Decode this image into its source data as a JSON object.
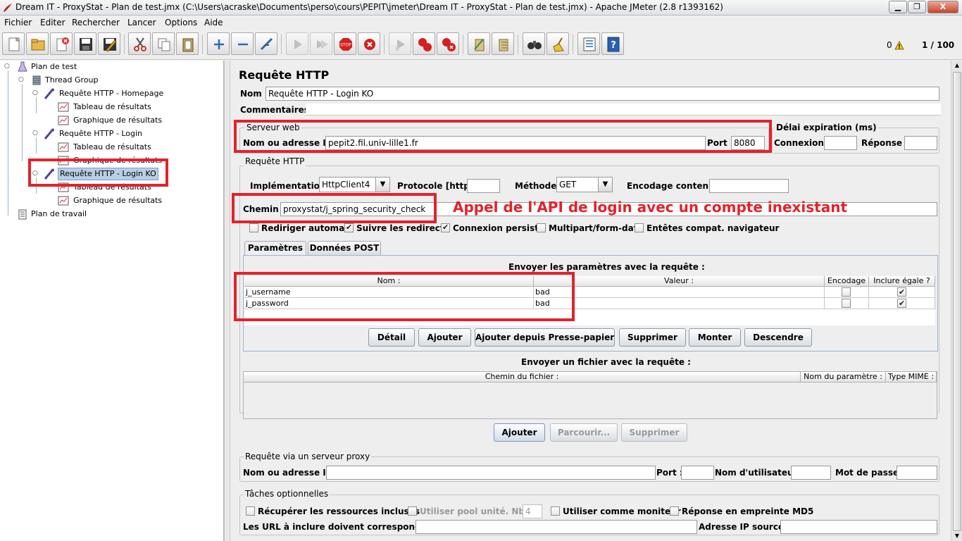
{
  "window": {
    "title": "Dream IT - ProxyStat - Plan de test.jmx (C:\\Users\\acraske\\Documents\\perso\\cours\\PEPIT\\jmeter\\Dream IT - ProxyStat - Plan de test.jmx) - Apache JMeter (2.8 r1393162)",
    "minimize": "▁",
    "maximize": "❐",
    "close": "X"
  },
  "menu": [
    "Fichier",
    "Editer",
    "Rechercher",
    "Lancer",
    "Options",
    "Aide"
  ],
  "toolbar": {
    "error_count": "0",
    "threads": "1 / 100",
    "icons": [
      "new-icon",
      "open-icon",
      "close-file-icon",
      "save-icon",
      "save-as-icon",
      "cut-icon",
      "copy-icon",
      "paste-icon",
      "expand-icon",
      "collapse-icon",
      "toggle-icon",
      "start-icon",
      "start-no-pause-icon",
      "stop-icon",
      "shutdown-icon",
      "remote-start-icon",
      "remote-stop-icon",
      "remote-shutdown-icon",
      "clear-icon",
      "clear-all-icon",
      "search-icon",
      "reset-search-icon",
      "function-helper-icon",
      "help-icon"
    ]
  },
  "tree": [
    {
      "label": "Plan de test",
      "icon": "test-plan-icon"
    },
    {
      "label": "Thread Group",
      "icon": "thread-group-icon"
    },
    {
      "label": "Requête HTTP - Homepage",
      "icon": "sampler-icon"
    },
    {
      "label": "Tableau de résultats",
      "icon": "listener-icon"
    },
    {
      "label": "Graphique de résultats",
      "icon": "listener-icon"
    },
    {
      "label": "Requête HTTP - Login",
      "icon": "sampler-icon"
    },
    {
      "label": "Tableau de résultats",
      "icon": "listener-icon"
    },
    {
      "label": "Graphique de résultats",
      "icon": "listener-icon"
    },
    {
      "label": "Requête HTTP - Login KO",
      "icon": "sampler-icon",
      "selected": true
    },
    {
      "label": "Tableau de résultats",
      "icon": "listener-icon"
    },
    {
      "label": "Graphique de résultats",
      "icon": "listener-icon"
    },
    {
      "label": "Plan de travail",
      "icon": "workbench-icon"
    }
  ],
  "panel": {
    "title": "Requête HTTP",
    "name_label": "Nom :",
    "name_value": "Requête HTTP - Login KO",
    "comments_label": "Commentaires :",
    "web_server": {
      "legend": "Serveur web",
      "host_label": "Nom ou adresse IP :",
      "host_value": "pepit2.fil.univ-lille1.fr",
      "port_label": "Port :",
      "port_value": "8080"
    },
    "timeout": {
      "legend": "Délai expiration (ms)",
      "connect_label": "Connexion :",
      "response_label": "Réponse :"
    },
    "http_request": {
      "legend": "Requête HTTP",
      "impl_label": "Implémentation :",
      "impl_value": "HttpClient4",
      "protocol_label": "Protocole [http] :",
      "method_label": "Méthode :",
      "method_value": "GET",
      "encoding_label": "Encodage contenu :",
      "path_label": "Chemin :",
      "path_value": "proxystat/j_spring_security_check",
      "options": [
        {
          "label": "Rediriger automat.",
          "checked": false
        },
        {
          "label": "Suivre les redirect.",
          "checked": true
        },
        {
          "label": "Connexion persist.",
          "checked": true
        },
        {
          "label": "Multipart/form-data",
          "checked": false
        },
        {
          "label": "Entêtes compat. navigateur",
          "checked": false
        }
      ]
    },
    "annotation": "Appel de l'API de login avec un compte inexistant",
    "tabs": [
      "Paramètres",
      "Données POST"
    ],
    "params": {
      "caption": "Envoyer les paramètres avec la requête :",
      "columns": [
        "Nom :",
        "Valeur :",
        "Encodage",
        "Inclure égale ?"
      ],
      "rows": [
        {
          "name": "j_username",
          "value": "bad",
          "encode": false,
          "include": true
        },
        {
          "name": "j_password",
          "value": "bad",
          "encode": false,
          "include": true
        }
      ],
      "buttons": [
        "Détail",
        "Ajouter",
        "Ajouter depuis Presse-papier",
        "Supprimer",
        "Monter",
        "Descendre"
      ]
    },
    "files": {
      "caption": "Envoyer un fichier avec la requête :",
      "columns": [
        "Chemin du fichier :",
        "Nom du paramètre :",
        "Type MIME :"
      ],
      "buttons": [
        "Ajouter",
        "Parcourir...",
        "Supprimer"
      ]
    },
    "proxy": {
      "legend": "Requête via un serveur proxy",
      "host_label": "Nom ou adresse IP :",
      "port_label": "Port :",
      "user_label": "Nom d'utilisateur :",
      "password_label": "Mot de passe :"
    },
    "optional": {
      "legend": "Tâches optionnelles",
      "retrieve_label": "Récupérer les ressources incluses",
      "pool_label": "Utiliser pool unité. Nbre :",
      "pool_value": "4",
      "monitor_label": "Utiliser comme moniteur",
      "md5_label": "Réponse en empreinte MD5",
      "urls_label": "Les URL à inclure doivent correspondre à :",
      "ip_source_label": "Adresse IP source :"
    }
  },
  "colors": {
    "highlight": "#e3222b",
    "selection": "#b8cfe5"
  }
}
